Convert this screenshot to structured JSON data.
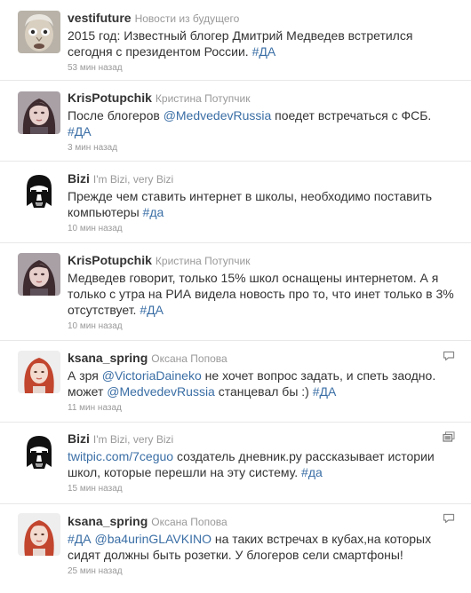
{
  "tweets": [
    {
      "screen_name": "vestifuture",
      "full_name": "Новости из будущего",
      "segments": [
        {
          "t": "2015 год: Известный блогер Дмитрий Медведев встретился сегодня с президентом России. ",
          "link": false
        },
        {
          "t": "#ДА",
          "link": true
        }
      ],
      "time": "53 мин назад",
      "avatar": "face-avatar",
      "side_icon": null
    },
    {
      "screen_name": "KrisPotupchik",
      "full_name": "Кристина Потупчик",
      "segments": [
        {
          "t": "После блогеров ",
          "link": false
        },
        {
          "t": "@MedvedevRussia",
          "link": true
        },
        {
          "t": " поедет встречаться с ФСБ. ",
          "link": false
        },
        {
          "t": "#ДА",
          "link": true
        }
      ],
      "time": "3 мин назад",
      "avatar": "woman-avatar",
      "side_icon": null
    },
    {
      "screen_name": "Bizi",
      "full_name": "I'm Bizi, very Bizi",
      "segments": [
        {
          "t": "Прежде чем ставить интернет в школы, необходимо поставить компьютеры ",
          "link": false
        },
        {
          "t": "#да",
          "link": true
        }
      ],
      "time": "10 мин назад",
      "avatar": "vader-avatar",
      "side_icon": null
    },
    {
      "screen_name": "KrisPotupchik",
      "full_name": "Кристина Потупчик",
      "segments": [
        {
          "t": "Медведев говорит, только 15% школ оснащены интернетом. А я только с утра на РИА видела новость про то, что инет только в 3% отсутствует. ",
          "link": false
        },
        {
          "t": "#ДА",
          "link": true
        }
      ],
      "time": "10 мин назад",
      "avatar": "woman-avatar",
      "side_icon": null
    },
    {
      "screen_name": "ksana_spring",
      "full_name": "Оксана Попова",
      "segments": [
        {
          "t": "А зря ",
          "link": false
        },
        {
          "t": "@VictoriaDaineko",
          "link": true
        },
        {
          "t": " не хочет вопрос задать, и спеть заодно. может ",
          "link": false
        },
        {
          "t": "@MedvedevRussia",
          "link": true
        },
        {
          "t": " станцевал бы :) ",
          "link": false
        },
        {
          "t": "#ДА",
          "link": true
        }
      ],
      "time": "11 мин назад",
      "avatar": "redhead-avatar",
      "side_icon": "reply-bubble-icon"
    },
    {
      "screen_name": "Bizi",
      "full_name": "I'm Bizi, very Bizi",
      "segments": [
        {
          "t": "twitpic.com/7ceguo",
          "link": true
        },
        {
          "t": " создатель дневник.ру рассказывает истории школ, которые перешли на эту систему. ",
          "link": false
        },
        {
          "t": "#да",
          "link": true
        }
      ],
      "time": "15 мин назад",
      "avatar": "vader-avatar",
      "side_icon": "media-photo-icon"
    },
    {
      "screen_name": "ksana_spring",
      "full_name": "Оксана Попова",
      "segments": [
        {
          "t": "#ДА",
          "link": true
        },
        {
          "t": " ",
          "link": false
        },
        {
          "t": "@ba4urinGLAVKINO",
          "link": true
        },
        {
          "t": " на таких встречах в кубах,на которых сидят должны быть розетки. У блогеров сели смартфоны!",
          "link": false
        }
      ],
      "time": "25 мин назад",
      "avatar": "redhead-avatar",
      "side_icon": "reply-bubble-icon"
    }
  ]
}
